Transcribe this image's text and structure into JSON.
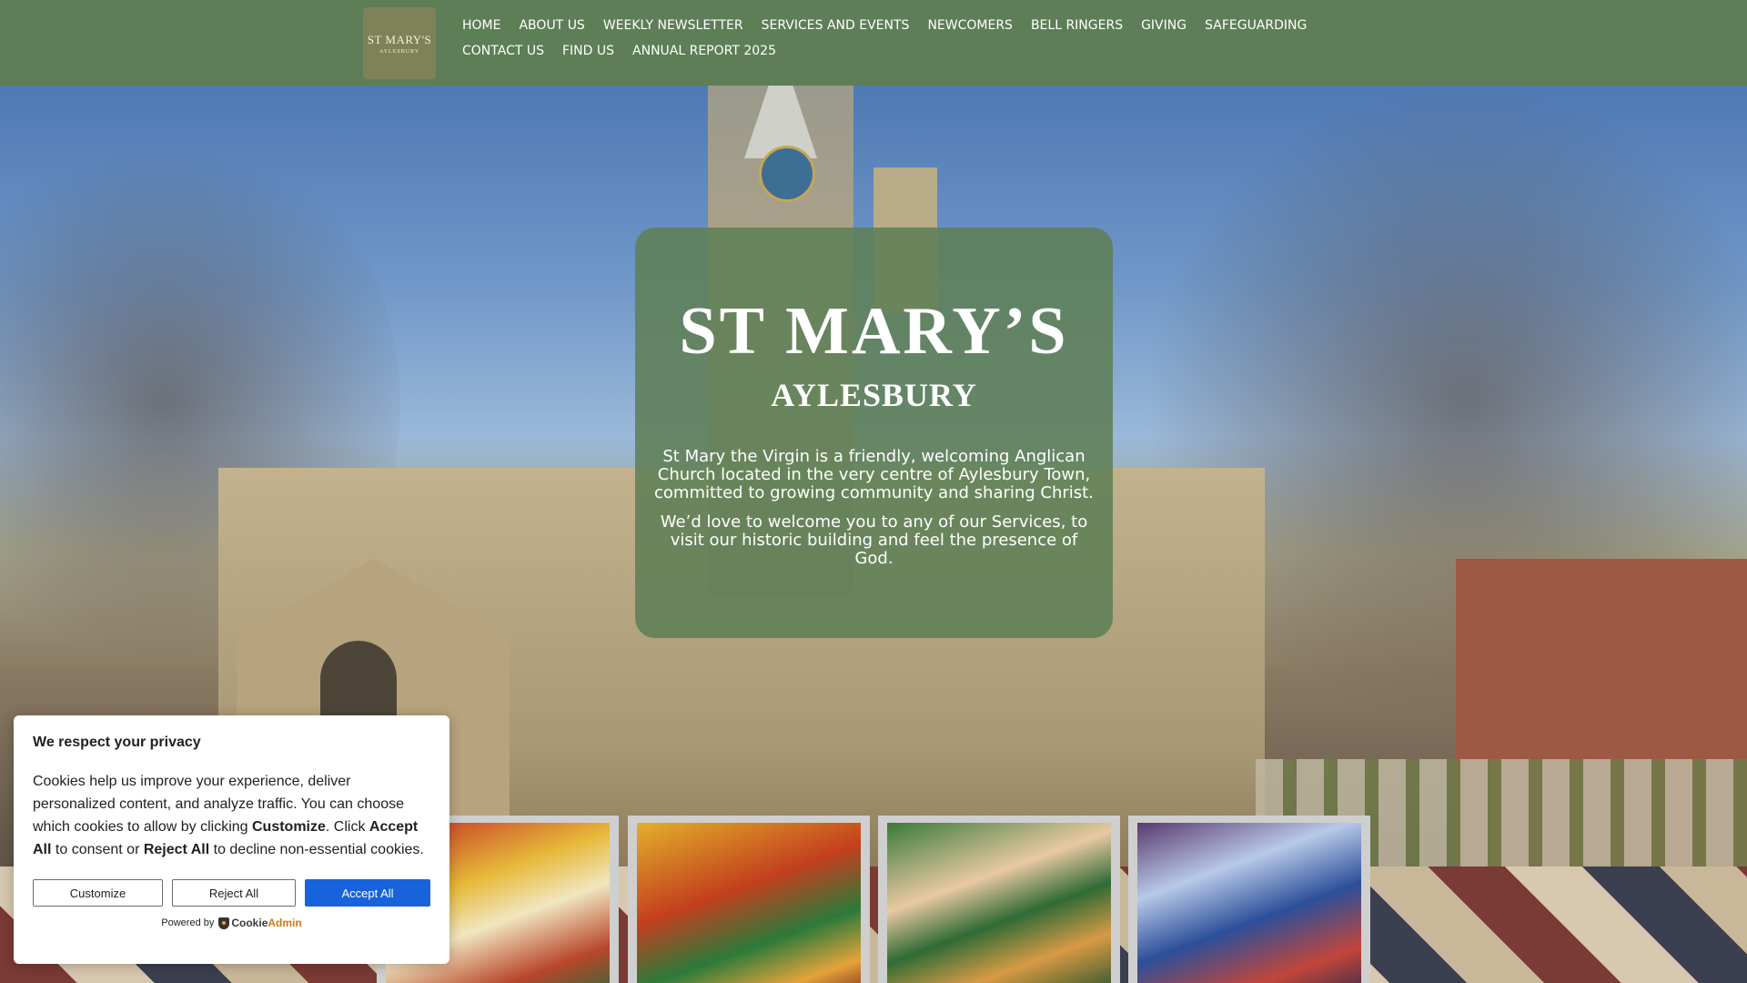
{
  "logo": {
    "title": "ST MARY'S",
    "subtitle": "AYLESBURY"
  },
  "nav": {
    "items": [
      {
        "label": "HOME"
      },
      {
        "label": "ABOUT US"
      },
      {
        "label": "WEEKLY NEWSLETTER"
      },
      {
        "label": "SERVICES AND EVENTS"
      },
      {
        "label": "NEWCOMERS"
      },
      {
        "label": "BELL RINGERS"
      },
      {
        "label": "GIVING"
      },
      {
        "label": "SAFEGUARDING"
      },
      {
        "label": "CONTACT US"
      },
      {
        "label": "FIND US"
      },
      {
        "label": "ANNUAL REPORT 2025"
      }
    ]
  },
  "hero": {
    "title": "ST MARY’S",
    "subtitle": "AYLESBURY",
    "paragraph1": "St Mary the Virgin is a friendly, welcoming Anglican Church located in the very centre of Aylesbury Town, committed to growing community and sharing Christ.",
    "paragraph2": "We’d love to welcome you to any of our Services, to visit our historic building and feel the presence of God."
  },
  "gallery": {
    "items": [
      {
        "icon": "stained-glass-window"
      },
      {
        "icon": "stained-glass-window"
      },
      {
        "icon": "stained-glass-window"
      },
      {
        "icon": "stained-glass-window"
      }
    ]
  },
  "cookie": {
    "title": "We respect your privacy",
    "body_part1": "Cookies help us improve your experience, deliver personalized content, and analyze traffic. You can choose which cookies to allow by clicking ",
    "customize_word": "Customize",
    "body_part2": ". Click ",
    "accept_word": "Accept All",
    "body_part3": " to consent or ",
    "reject_word": "Reject All",
    "body_part4": " to decline non-essential cookies.",
    "customize_label": "Customize",
    "reject_label": "Reject All",
    "accept_label": "Accept All",
    "powered_by": "Powered by",
    "brand_cookie": "Cookie",
    "brand_admin": "Admin"
  },
  "colors": {
    "header_bg": "#5d7e56",
    "card_bg": "#5e8056",
    "accept_blue": "#1863dc"
  }
}
